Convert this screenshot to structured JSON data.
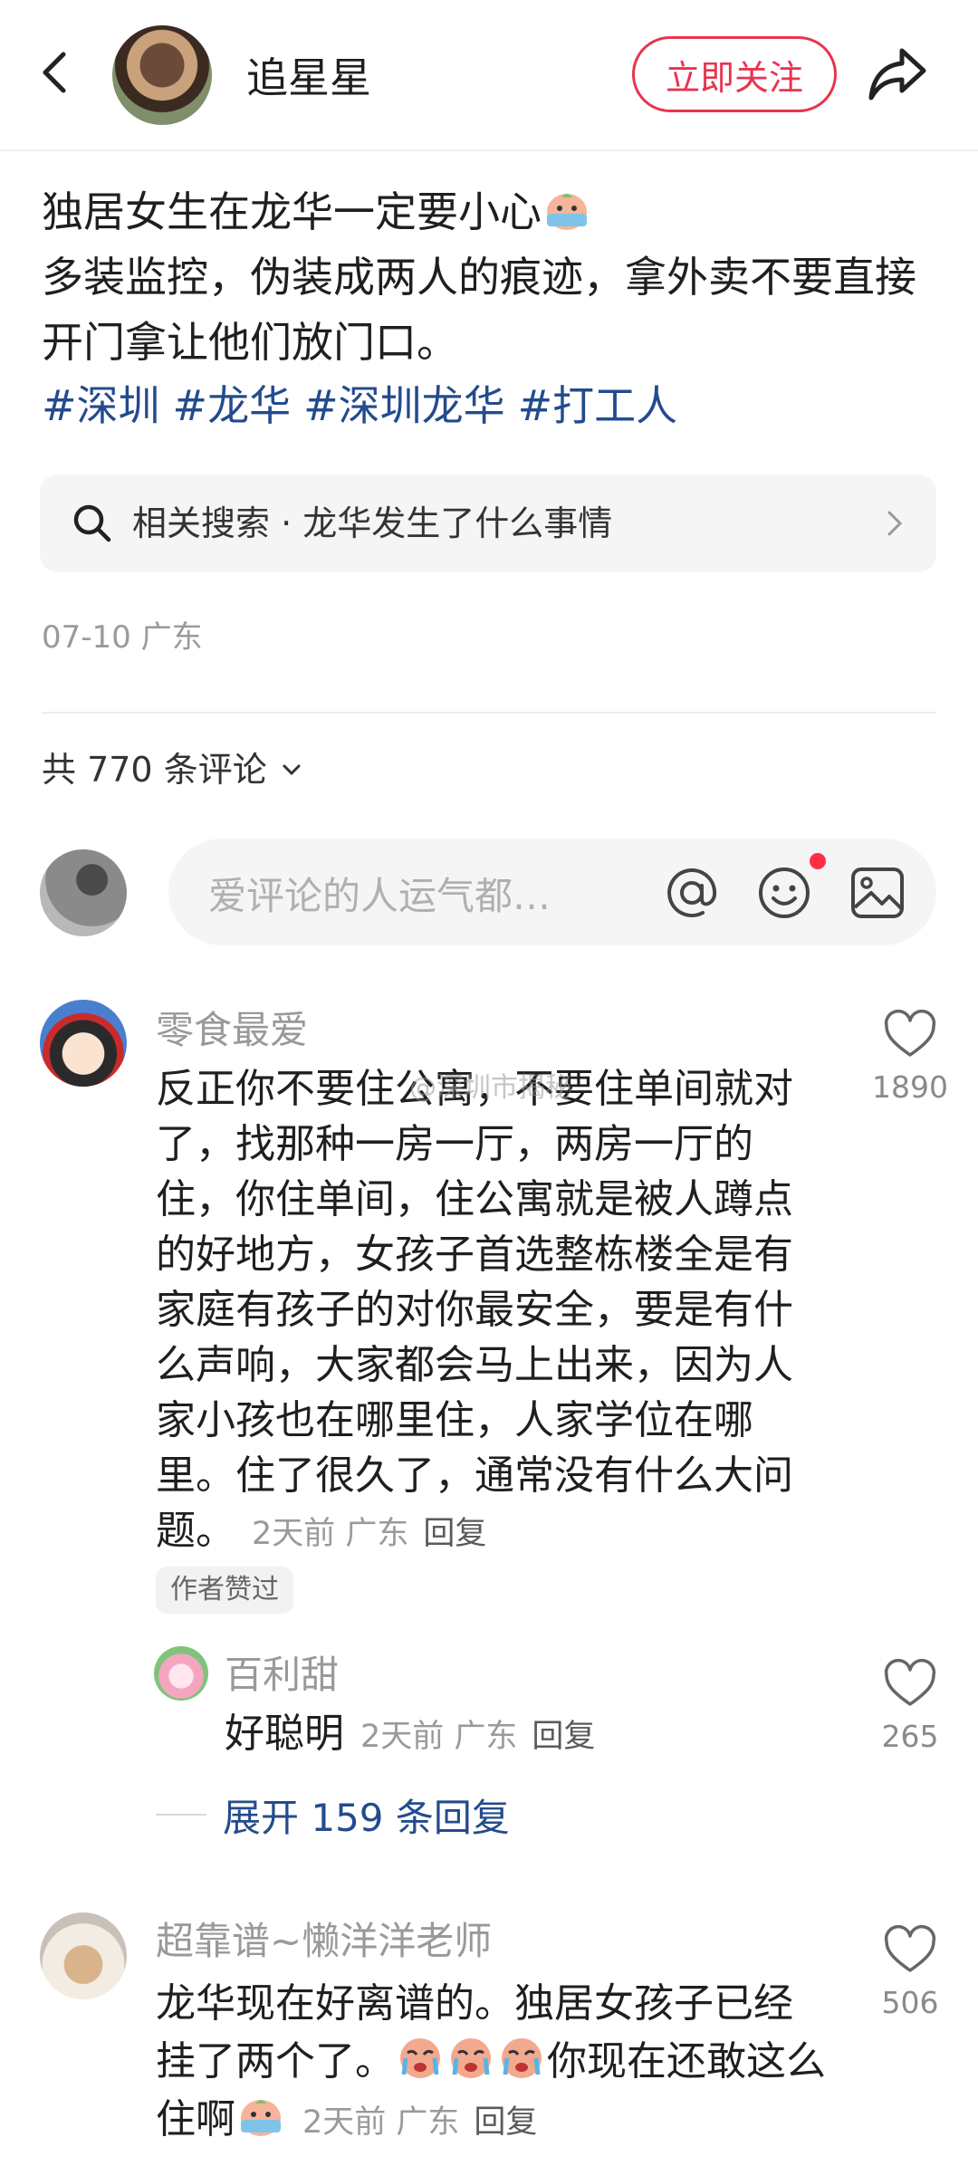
{
  "header": {
    "author_name": "追星星",
    "follow_label": "立即关注"
  },
  "post": {
    "title": "独居女生在龙华一定要小心",
    "body": "多装监控，伪装成两人的痕迹，拿外卖不要直接开门拿让他们放门口。",
    "tags": [
      "#深圳",
      "#龙华",
      "#深圳龙华",
      "#打工人"
    ],
    "date_location": "07-10 广东"
  },
  "related_search": {
    "text": "相关搜索 · 龙华发生了什么事情"
  },
  "comments_header": {
    "count_label": "共 770 条评论"
  },
  "comment_input": {
    "placeholder": "爱评论的人运气都…"
  },
  "comments": [
    {
      "user": "零食最爱",
      "text": "反正你不要住公寓，不要住单间就对了，找那种一房一厅，两房一厅的住，你住单间，住公寓就是被人蹲点的好地方，女孩子首选整栋楼全是有家庭有孩子的对你最安全，要是有什么声响，大家都会马上出来，因为人家小孩也在哪里住，人家学位在哪里。住了很久了，通常没有什么大问题。",
      "time_location": "2天前 广东",
      "reply_label": "回复",
      "likes": "1890",
      "badge": "作者赞过",
      "replies": [
        {
          "user": "百利甜",
          "text": "好聪明",
          "time_location": "2天前 广东",
          "reply_label": "回复",
          "likes": "265"
        }
      ],
      "expand_label": "展开 159 条回复"
    },
    {
      "user": "超靠谱~懒洋洋老师",
      "text_part1": "龙华现在好离谱的。独居女孩子已经挂了两个了。",
      "text_part2": "你现在还敢这么住啊",
      "time_location": "2天前 广东",
      "reply_label": "回复",
      "likes": "506"
    }
  ],
  "watermark": "@深圳市揭秘"
}
